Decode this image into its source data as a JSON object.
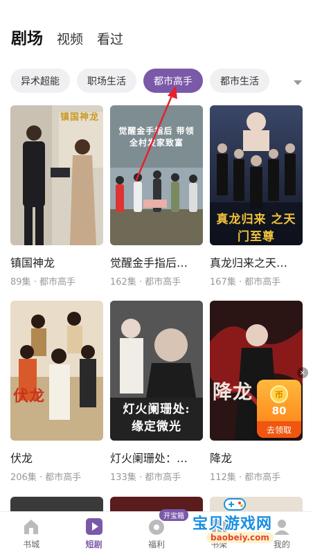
{
  "header": {
    "tabs": [
      {
        "label": "剧场",
        "active": true
      },
      {
        "label": "视频",
        "active": false
      },
      {
        "label": "看过",
        "active": false
      }
    ]
  },
  "categories": {
    "items": [
      "异术超能",
      "职场生活",
      "都市高手",
      "都市生活"
    ],
    "active_index": 2
  },
  "dramas": [
    {
      "title": "镇国神龙",
      "episodes": "89集",
      "genre": "都市高手",
      "cover_text": "镇国神龙",
      "cover_colors": [
        "#d8d2c4",
        "#8c8474"
      ]
    },
    {
      "title": "觉醒金手指后…",
      "episodes": "162集",
      "genre": "都市高手",
      "cover_text": "觉醒金手指后 带领全村发家致富",
      "cover_colors": [
        "#9aa9b2",
        "#6f6a55"
      ]
    },
    {
      "title": "真龙归来之天…",
      "episodes": "167集",
      "genre": "都市高手",
      "cover_text": "真龙归来 之天门至尊",
      "cover_colors": [
        "#2a3550",
        "#151a2a"
      ]
    },
    {
      "title": "伏龙",
      "episodes": "206集",
      "genre": "都市高手",
      "cover_text": "伏龙",
      "cover_colors": [
        "#e9dcc8",
        "#b89668"
      ]
    },
    {
      "title": "灯火阑珊处：…",
      "episodes": "133集",
      "genre": "都市高手",
      "cover_text": "灯火阑珊处: 缘定微光",
      "cover_colors": [
        "#4a4a4a",
        "#1e1e1e"
      ]
    },
    {
      "title": "降龙",
      "episodes": "112集",
      "genre": "都市高手",
      "cover_text": "降龙",
      "cover_colors": [
        "#3a1a1a",
        "#a02020"
      ]
    }
  ],
  "reward": {
    "amount": "80",
    "claim_label": "去领取",
    "coin_symbol": "币"
  },
  "bottom_nav": {
    "items": [
      {
        "label": "书城",
        "icon": "home-icon",
        "active": false
      },
      {
        "label": "短剧",
        "icon": "play-icon",
        "active": true
      },
      {
        "label": "福利",
        "icon": "gift-icon",
        "active": false,
        "badge": "开宝箱"
      },
      {
        "label": "书架",
        "icon": "bookshelf-icon",
        "active": false
      },
      {
        "label": "我的",
        "icon": "profile-icon",
        "active": false
      }
    ]
  },
  "watermark": {
    "title": "宝贝游戏网",
    "url": "baobeiy.com"
  },
  "colors": {
    "accent": "#7a59a8",
    "annotation_arrow": "#e8202a",
    "reward_orange": "#ff7b12"
  }
}
